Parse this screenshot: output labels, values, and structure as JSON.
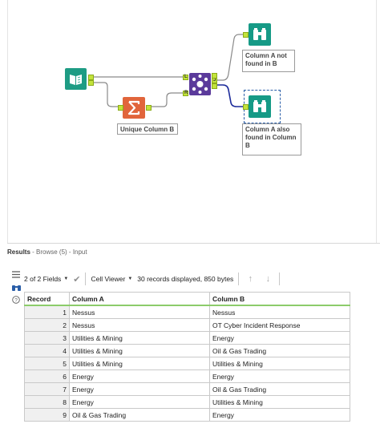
{
  "workflow": {
    "tools": {
      "input_label": "",
      "summarize_label": "Unique Column B",
      "browse_top_label": "Column A not found in B",
      "browse_bottom_label": "Column A also found in Column B"
    },
    "join_anchors": {
      "left": "L",
      "right": "R",
      "j": "J"
    }
  },
  "results": {
    "title": "Results",
    "subtitle": "- Browse (5) - Input",
    "fields_selector": "2 of 2 Fields",
    "cell_viewer": "Cell Viewer",
    "status": "30 records displayed, 850 bytes",
    "columns": [
      "Record",
      "Column A",
      "Column B"
    ],
    "rows": [
      {
        "record": "1",
        "a": "Nessus",
        "b": "Nessus"
      },
      {
        "record": "2",
        "a": "Nessus",
        "b": "OT Cyber Incident Response"
      },
      {
        "record": "3",
        "a": "Utilities & Mining",
        "b": "Energy"
      },
      {
        "record": "4",
        "a": "Utilities & Mining",
        "b": "Oil & Gas Trading"
      },
      {
        "record": "5",
        "a": "Utilities & Mining",
        "b": "Utilities & Mining"
      },
      {
        "record": "6",
        "a": "Energy",
        "b": "Energy"
      },
      {
        "record": "7",
        "a": "Energy",
        "b": "Oil & Gas Trading"
      },
      {
        "record": "8",
        "a": "Energy",
        "b": "Utilities & Mining"
      },
      {
        "record": "9",
        "a": "Oil & Gas Trading",
        "b": "Energy"
      }
    ]
  },
  "icons": {
    "input": "book-icon",
    "summarize": "sigma-icon",
    "join": "join-icon",
    "browse": "binoculars-icon",
    "side": [
      "list-icon",
      "binoculars-icon",
      "help-icon"
    ]
  }
}
